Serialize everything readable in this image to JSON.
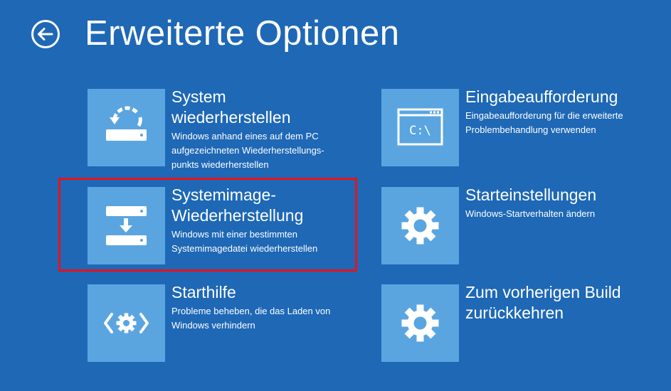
{
  "header": {
    "title": "Erweiterte Optionen",
    "back_icon": "back-arrow-icon"
  },
  "options": [
    {
      "icon": "system-restore-icon",
      "title_lines": [
        "System",
        "wiederherstellen"
      ],
      "desc_lines": [
        "Windows anhand eines auf dem PC",
        "aufgezeichneten Wiederherstellungs-",
        "punkts wiederherstellen"
      ]
    },
    {
      "icon": "command-prompt-icon",
      "icon_text": "C:\\",
      "title_lines": [
        "Eingabeaufforderung"
      ],
      "desc_lines": [
        "Eingabeaufforderung für die erweiterte",
        "Problembehandlung verwenden"
      ]
    },
    {
      "icon": "system-image-recovery-icon",
      "title_lines": [
        "Systemimage-",
        "Wiederherstellung"
      ],
      "desc_lines": [
        "Windows mit einer bestimmten",
        "Systemimagedatei wiederherstellen"
      ]
    },
    {
      "icon": "gear-icon",
      "title_lines": [
        "Starteinstellungen"
      ],
      "desc_lines": [
        "Windows-Startverhalten ändern"
      ]
    },
    {
      "icon": "startup-repair-icon",
      "title_lines": [
        "Starthilfe"
      ],
      "desc_lines": [
        "Probleme beheben, die das Laden von",
        "Windows verhindern"
      ]
    },
    {
      "icon": "gear-icon",
      "title_lines": [
        "Zum vorherigen Build",
        "zurückkehren"
      ],
      "desc_lines": []
    }
  ],
  "colors": {
    "background": "#1e68b6",
    "tile": "#5aa5e0",
    "highlight": "#e8121c"
  }
}
